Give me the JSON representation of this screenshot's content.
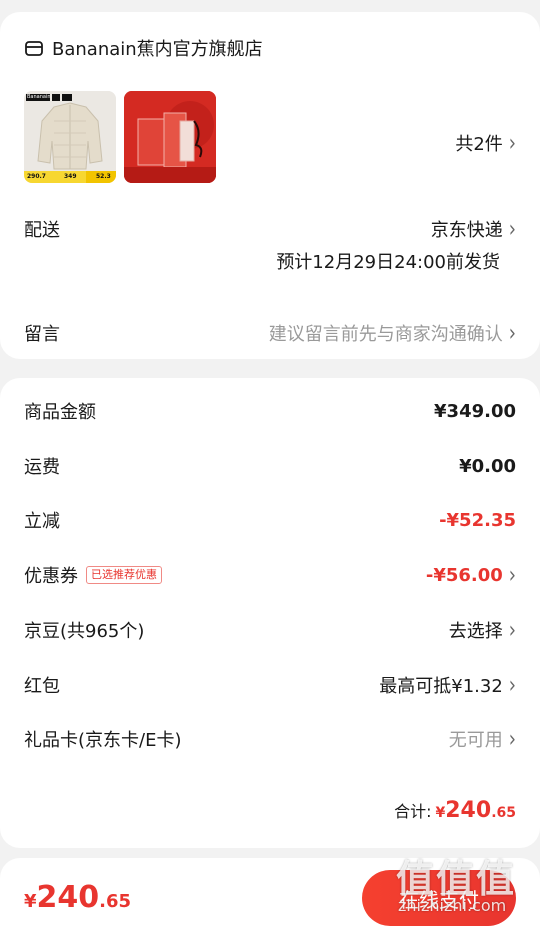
{
  "store": {
    "name": "Bananain蕉内官方旗舰店",
    "icon": "store-icon"
  },
  "products": {
    "thumb1": {
      "brand_tag": "Bananain",
      "price_left": "290.7",
      "price_mid": "349",
      "price_right": "52.3"
    },
    "thumb2": {
      "alt": "red-gift-box"
    },
    "count_label": "共2件"
  },
  "delivery": {
    "label": "配送",
    "value": "京东快递",
    "eta": "预计12月29日24:00前发货"
  },
  "message": {
    "label": "留言",
    "placeholder": "建议留言前先与商家沟通确认"
  },
  "summary": {
    "goods": {
      "label": "商品金额",
      "value": "¥349.00"
    },
    "shipping": {
      "label": "运费",
      "value": "¥0.00"
    },
    "discount": {
      "label": "立减",
      "value": "-¥52.35"
    },
    "coupon": {
      "label": "优惠券",
      "badge": "已选推荐优惠",
      "value": "-¥56.00"
    },
    "jingdou": {
      "label": "京豆(共965个)",
      "value": "去选择"
    },
    "redpacket": {
      "label": "红包",
      "value": "最高可抵¥1.32"
    },
    "giftcard": {
      "label": "礼品卡(京东卡/E卡)",
      "value": "无可用"
    },
    "total": {
      "label": "合计:",
      "currency": "¥",
      "integer": "240",
      "decimal": ".65"
    }
  },
  "paybar": {
    "currency": "¥",
    "integer": "240",
    "decimal": ".65",
    "button_label": "在线支付"
  },
  "watermark": {
    "logo": "值值值",
    "url": "zhizhizhi.com"
  },
  "colors": {
    "accent_red": "#e8352f",
    "muted": "#9a9a9a",
    "background": "#f2f2f2"
  }
}
